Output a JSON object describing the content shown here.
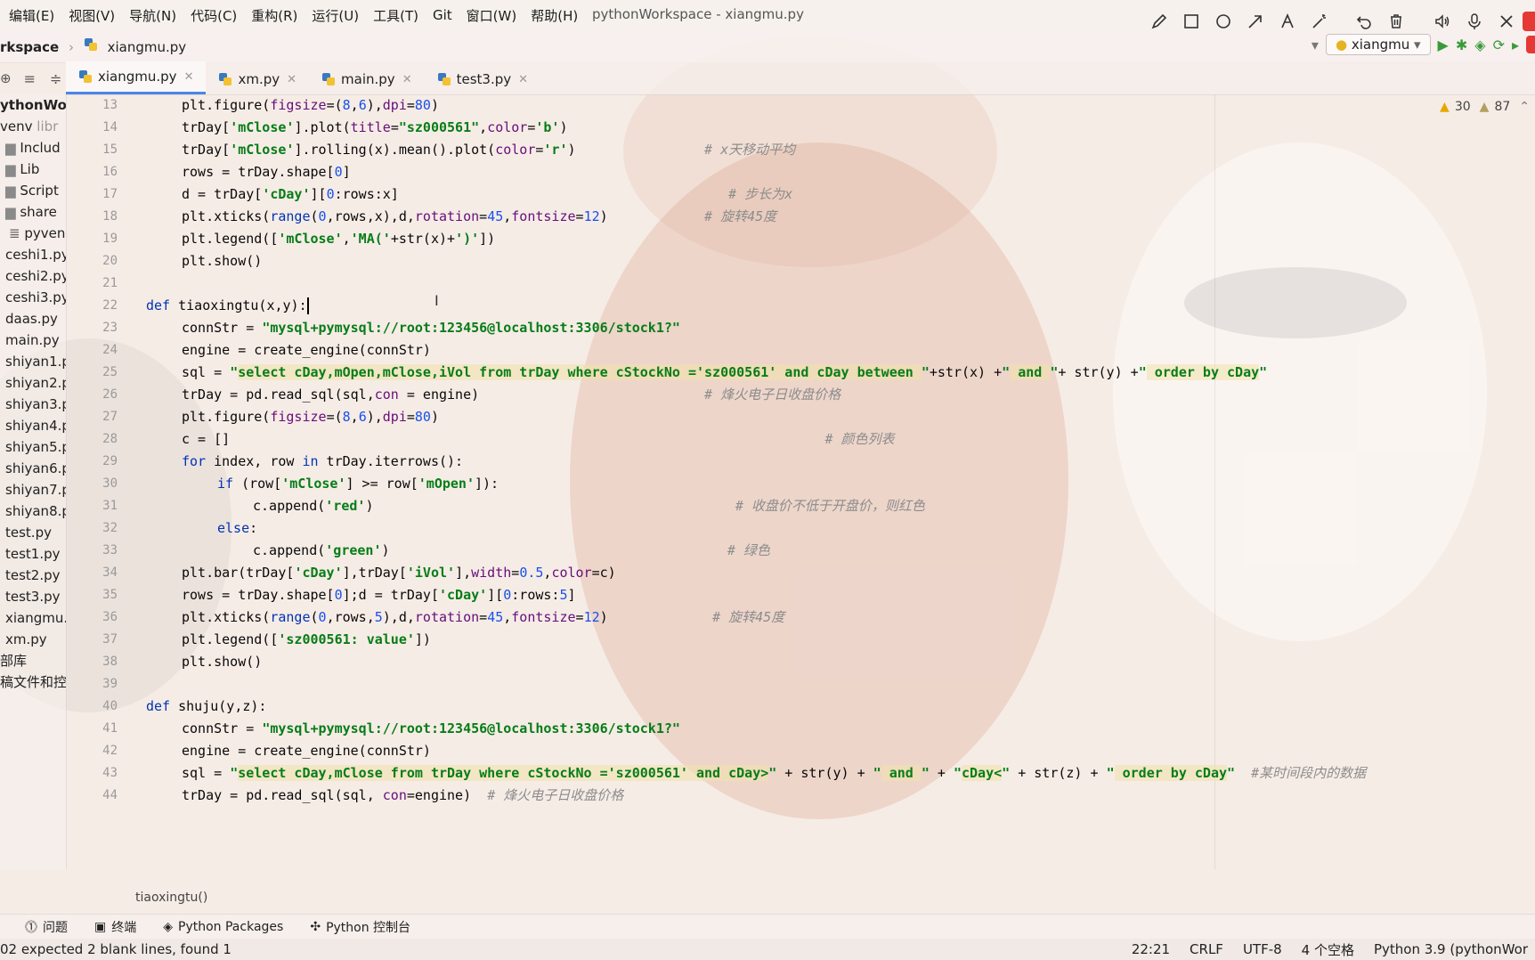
{
  "menu": [
    "编辑(E)",
    "视图(V)",
    "导航(N)",
    "代码(C)",
    "重构(R)",
    "运行(U)",
    "工具(T)",
    "Git",
    "窗口(W)",
    "帮助(H)"
  ],
  "window_title": "pythonWorkspace - xiangmu.py",
  "breadcrumb": {
    "project": "rkspace",
    "file": "xiangmu.py"
  },
  "run_config": "xiangmu",
  "tabs": [
    {
      "label": "xiangmu.py",
      "active": true
    },
    {
      "label": "xm.py",
      "active": false
    },
    {
      "label": "main.py",
      "active": false
    },
    {
      "label": "test3.py",
      "active": false
    }
  ],
  "sidebar": {
    "root": "ythonWor",
    "items": [
      "venv",
      "Includ",
      "Lib",
      "Script",
      "share",
      "pyven",
      "ceshi1.py",
      "ceshi2.py",
      "ceshi3.py",
      "daas.py",
      "main.py",
      "shiyan1.p",
      "shiyan2.p",
      "shiyan3.p",
      "shiyan4.p",
      "shiyan5.p",
      "shiyan6.p",
      "shiyan7.p",
      "shiyan8.p",
      "test.py",
      "test1.py",
      "test2.py",
      "test3.py",
      "xiangmu.",
      "xm.py",
      "部库",
      "稿文件和控"
    ],
    "venv_hint": "libr"
  },
  "inspections": {
    "warnings": "30",
    "weak": "87"
  },
  "line_numbers": [
    "13",
    "14",
    "15",
    "16",
    "17",
    "18",
    "19",
    "20",
    "21",
    "22",
    "23",
    "24",
    "25",
    "26",
    "27",
    "28",
    "29",
    "30",
    "31",
    "32",
    "33",
    "34",
    "35",
    "36",
    "37",
    "38",
    "39",
    "40",
    "41",
    "42",
    "43",
    "44"
  ],
  "code_breadcrumb": "tiaoxingtu()",
  "toolwindows": [
    "问题",
    "终端",
    "Python Packages",
    "Python 控制台"
  ],
  "status": {
    "message": "02 expected 2 blank lines, found 1",
    "position": "22:21",
    "line_sep": "CRLF",
    "encoding": "UTF-8",
    "indent": "4 个空格",
    "interpreter": "Python 3.9 (pythonWor"
  },
  "colors": {
    "keyword": "#0033b3",
    "string": "#067d17",
    "number": "#1750eb",
    "comment": "#8c8c8c",
    "active_tab": "#4a86e8"
  }
}
